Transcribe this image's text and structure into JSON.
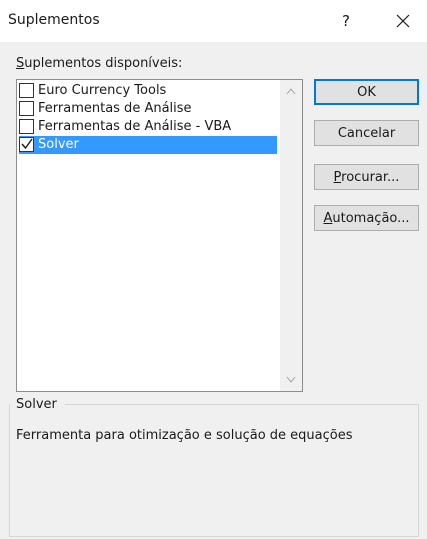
{
  "window": {
    "title": "Suplementos",
    "help_label": "?",
    "close_icon": "close-icon"
  },
  "list": {
    "label_prefix": "",
    "label_accel": "S",
    "label_rest": "uplementos disponíveis:",
    "items": [
      {
        "label": "Euro Currency Tools",
        "checked": false,
        "selected": false
      },
      {
        "label": "Ferramentas de Análise",
        "checked": false,
        "selected": false
      },
      {
        "label": "Ferramentas de Análise - VBA",
        "checked": false,
        "selected": false
      },
      {
        "label": "Solver",
        "checked": true,
        "selected": true
      }
    ]
  },
  "buttons": {
    "ok": "OK",
    "cancel": "Cancelar",
    "browse_accel": "P",
    "browse_rest": "rocurar...",
    "automation_accel": "A",
    "automation_rest": "utomação..."
  },
  "description": {
    "title": "Solver",
    "text": "Ferramenta para otimização e solução de equações"
  },
  "colors": {
    "selection": "#3399ff",
    "default_button_border": "#0078d7"
  }
}
